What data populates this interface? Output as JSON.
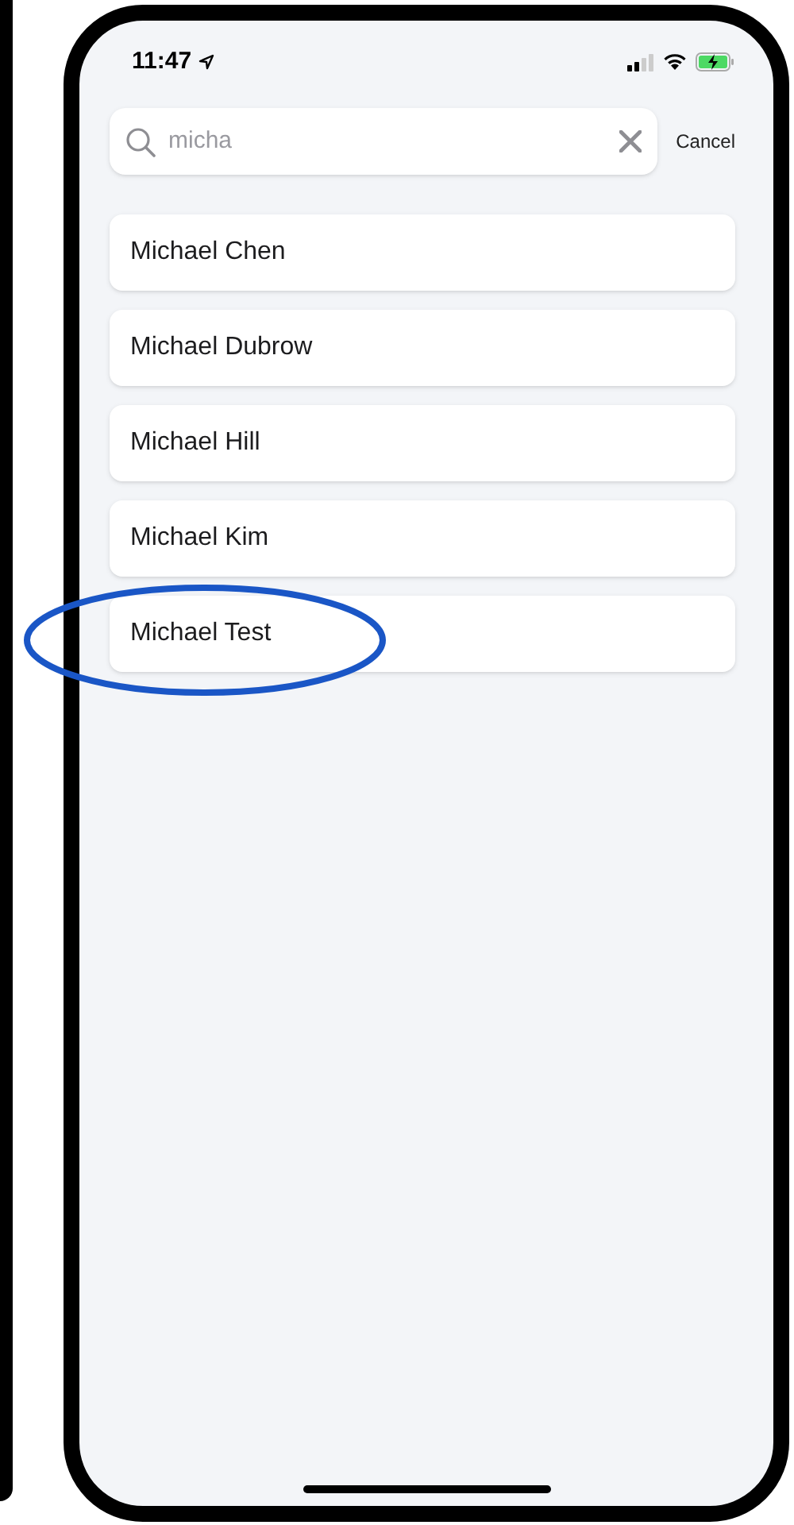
{
  "status_bar": {
    "time": "11:47"
  },
  "search": {
    "value": "micha",
    "cancel_label": "Cancel"
  },
  "results": [
    {
      "name": "Michael Chen",
      "highlighted": false
    },
    {
      "name": "Michael Dubrow",
      "highlighted": false
    },
    {
      "name": "Michael Hill",
      "highlighted": false
    },
    {
      "name": "Michael Kim",
      "highlighted": false
    },
    {
      "name": "Michael Test",
      "highlighted": true
    }
  ]
}
